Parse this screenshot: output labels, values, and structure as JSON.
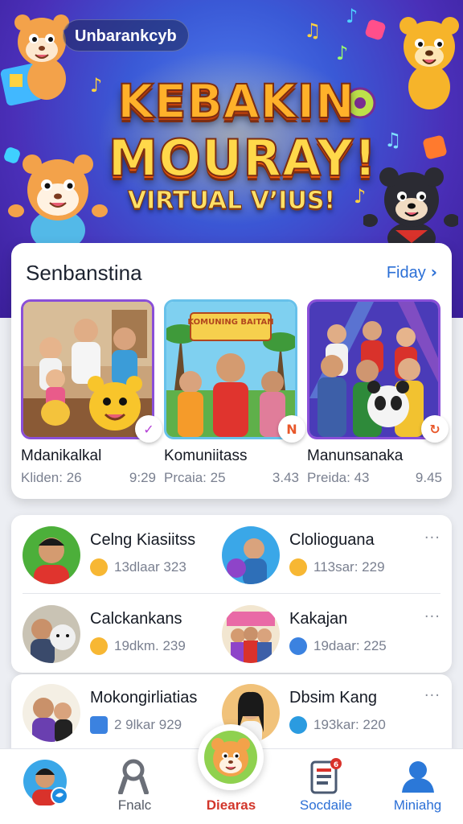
{
  "hero": {
    "chip": "Unbarankcyb",
    "title_line1": "KEBAKIN",
    "title_line2": "MOURAY!",
    "subtitle": "VIRTUAL V’IUS!"
  },
  "featured": {
    "title": "Senbanstina",
    "link_label": "Fiday",
    "items": [
      {
        "title": "Mdanikalkal",
        "meta": "Kliden: 26",
        "time": "9:29",
        "badge_color": "#b33fd6"
      },
      {
        "title": "Komuniitass",
        "meta": "Prcaia: 25",
        "time": "3.43",
        "badge_color": "#e8572a"
      },
      {
        "title": "Manunsanaka",
        "meta": "Preida: 43",
        "time": "9.45",
        "badge_color": "#e8572a"
      }
    ],
    "banner_text": "KOMUNING BAITAN"
  },
  "list": [
    {
      "name": "Celng Kiasiitss",
      "meta": "13dlaar 323"
    },
    {
      "name": "Clolioguana",
      "meta": "113sar: 229"
    },
    {
      "name": "Calckankans",
      "meta": "19dkm. 239"
    },
    {
      "name": "Kakajan",
      "meta": "19daar: 225"
    },
    {
      "name": "Mokongirliatias",
      "meta": "2 9lkar 929"
    },
    {
      "name": "Dbsim Kang",
      "meta": "193kar: 220"
    }
  ],
  "more_label": "···",
  "nav": {
    "items": [
      {
        "label": "",
        "icon": "profile-avatar"
      },
      {
        "label": "Fnalc",
        "icon": "person-icon"
      },
      {
        "label": "Diearas",
        "icon": "hamster-mascot"
      },
      {
        "label": "Socdaile",
        "icon": "document-icon"
      },
      {
        "label": "Miniahg",
        "icon": "user-icon"
      }
    ],
    "accent": "#d2362b",
    "blue": "#2b6fd6"
  }
}
